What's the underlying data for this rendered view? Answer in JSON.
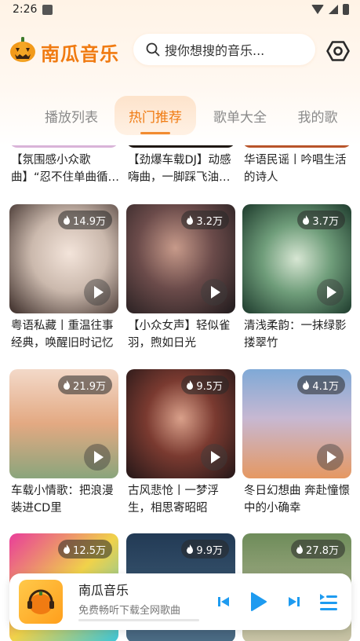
{
  "status": {
    "time": "2:26"
  },
  "header": {
    "app_title": "南瓜音乐",
    "search_placeholder": "搜你想搜的音乐..."
  },
  "tabs": [
    {
      "label": "播放列表",
      "active": false
    },
    {
      "label": "热门推荐",
      "active": true
    },
    {
      "label": "歌单大全",
      "active": false
    },
    {
      "label": "我的歌",
      "active": false
    }
  ],
  "colors": {
    "accent": "#f07b12",
    "tab_inactive": "#8a8a8a"
  },
  "playlists": [
    {
      "title": "【氛围感小众歌曲】“忍不住单曲循…",
      "plays": ""
    },
    {
      "title": "【劲爆车载DJ】动感嗨曲，一脚踩飞油…",
      "plays": ""
    },
    {
      "title": "华语民谣丨吟唱生活的诗人",
      "plays": ""
    },
    {
      "title": "粤语私藏丨重温往事经典，唤醒旧时记忆",
      "plays": "14.9万"
    },
    {
      "title": "【小众女声】轻似雀羽，煦如日光",
      "plays": "3.2万"
    },
    {
      "title": "清浅柔韵：一抹绿影搂翠竹",
      "plays": "3.7万"
    },
    {
      "title": "车载小情歌：把浪漫装进CD里",
      "plays": "21.9万"
    },
    {
      "title": "古风悲怆丨一梦浮生，相思寄昭昭",
      "plays": "9.5万"
    },
    {
      "title": "冬日幻想曲 奔赴憧憬中的小确幸",
      "plays": "4.1万"
    },
    {
      "title": "",
      "plays": "12.5万"
    },
    {
      "title": "",
      "plays": "9.9万"
    },
    {
      "title": "",
      "plays": "27.8万"
    }
  ],
  "player": {
    "title": "南瓜音乐",
    "subtitle": "免费畅听下载全网歌曲"
  }
}
